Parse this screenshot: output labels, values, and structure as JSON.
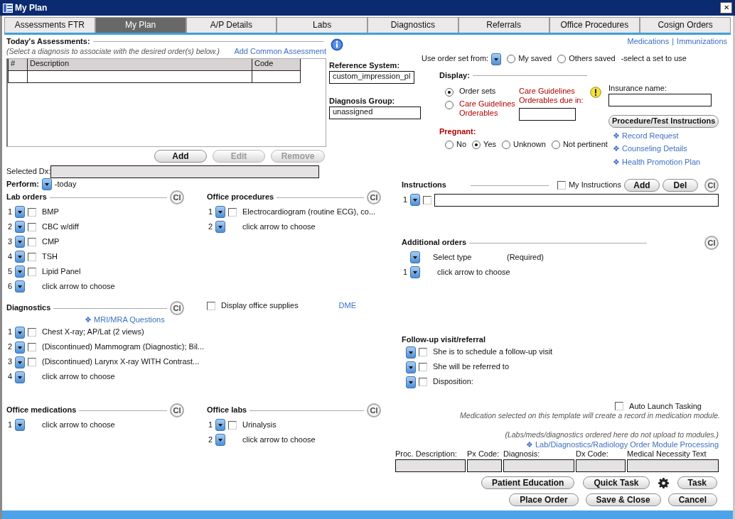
{
  "window": {
    "title": "My Plan",
    "close": "✕"
  },
  "tabs": [
    {
      "label": "Assessments FTR",
      "selected": false
    },
    {
      "label": "My Plan",
      "selected": true
    },
    {
      "label": "A/P Details",
      "selected": false
    },
    {
      "label": "Labs",
      "selected": false
    },
    {
      "label": "Diagnostics",
      "selected": false
    },
    {
      "label": "Referrals",
      "selected": false
    },
    {
      "label": "Office Procedures",
      "selected": false
    },
    {
      "label": "Cosign Orders",
      "selected": false
    }
  ],
  "assessments": {
    "title": "Today's Assessments:",
    "hint": "(Select a diagnosis to associate with the desired order(s) below.)",
    "add_common_link": "Add Common Assessment",
    "columns": [
      "#",
      "Description",
      "Code"
    ],
    "buttons": [
      {
        "label": "Add",
        "disabled": false
      },
      {
        "label": "Edit",
        "disabled": true
      },
      {
        "label": "Remove",
        "disabled": true
      }
    ],
    "selected_dx_label": "Selected Dx:"
  },
  "reference_system": {
    "label": "Reference System:",
    "value": "custom_impression_pl"
  },
  "diagnosis_group": {
    "label": "Diagnosis Group:",
    "value": "unassigned"
  },
  "top_links": {
    "items": [
      "Medications",
      "Immunizations"
    ],
    "separator": "|"
  },
  "order_set": {
    "label": "Use order set from:",
    "options": [
      {
        "label": "My saved",
        "selected": false
      },
      {
        "label": "Others saved",
        "selected": false
      }
    ],
    "hint": "-select a set to use"
  },
  "display": {
    "label": "Display:",
    "options": [
      {
        "label": "Order sets",
        "selected": true
      },
      {
        "label": "Care Guidelines Orderables",
        "selected": false
      }
    ],
    "due_label": "Care Guidelines Orderables due in:"
  },
  "insurance": {
    "label": "Insurance name:"
  },
  "procedure_button": "Procedure/Test Instructions",
  "side_links": [
    "❖ Record Request",
    "❖ Counseling Details",
    "❖ Health Promotion Plan"
  ],
  "pregnant": {
    "label": "Pregnant:",
    "options": [
      {
        "label": "No",
        "selected": false
      },
      {
        "label": "Yes",
        "selected": true
      },
      {
        "label": "Unknown",
        "selected": false
      },
      {
        "label": "Not pertinent",
        "selected": false
      }
    ]
  },
  "perform": {
    "label": "Perform:",
    "value": "-today"
  },
  "lab_orders": {
    "title": "Lab orders",
    "clear": "Cl",
    "rows": [
      {
        "number": "1",
        "kind": "item",
        "text": "BMP",
        "checked": false
      },
      {
        "number": "2",
        "kind": "item",
        "text": "CBC w/diff",
        "checked": false
      },
      {
        "number": "3",
        "kind": "item",
        "text": "CMP",
        "checked": false
      },
      {
        "number": "4",
        "kind": "item",
        "text": "TSH",
        "checked": false
      },
      {
        "number": "5",
        "kind": "item",
        "text": "Lipid Panel",
        "checked": false
      },
      {
        "number": "6",
        "kind": "choose",
        "text": "click arrow to choose"
      }
    ]
  },
  "office_procedures": {
    "title": "Office procedures",
    "clear": "Cl",
    "rows": [
      {
        "number": "1",
        "kind": "item",
        "text": "Electrocardiogram (routine ECG), co...",
        "checked": false
      },
      {
        "number": "2",
        "kind": "choose",
        "text": "click arrow to choose"
      }
    ]
  },
  "diagnostics": {
    "title": "Diagnostics",
    "clear": "Cl",
    "link": "❖ MRI/MRA Questions",
    "rows": [
      {
        "number": "1",
        "kind": "item",
        "text": "Chest X-ray; AP/Lat (2 views)",
        "checked": false
      },
      {
        "number": "2",
        "kind": "item",
        "text": "(Discontinued) Mammogram (Diagnostic); Bil...",
        "checked": false
      },
      {
        "number": "3",
        "kind": "item",
        "text": "(Discontinued) Larynx X-ray WITH Contrast...",
        "checked": false
      },
      {
        "number": "4",
        "kind": "choose",
        "text": "click arrow to choose"
      }
    ]
  },
  "office_supplies": {
    "label": "Display office supplies",
    "checked": false,
    "link": "DME"
  },
  "office_medications": {
    "title": "Office medications",
    "clear": "Cl",
    "rows": [
      {
        "number": "1",
        "kind": "choose",
        "text": "click arrow to choose"
      }
    ]
  },
  "office_labs": {
    "title": "Office labs",
    "clear": "Cl",
    "rows": [
      {
        "number": "1",
        "kind": "item",
        "text": "Urinalysis",
        "checked": false
      },
      {
        "number": "2",
        "kind": "choose",
        "text": "click arrow to choose"
      }
    ]
  },
  "instructions": {
    "title": "Instructions",
    "my_instructions": {
      "label": "My Instructions",
      "checked": false
    },
    "buttons": [
      "Add",
      "Del"
    ],
    "clear": "Cl",
    "rows": [
      {
        "number": "1",
        "checked": false
      }
    ]
  },
  "additional_orders": {
    "title": "Additional orders",
    "clear": "Cl",
    "type_label": "Select type",
    "required": "(Required)",
    "rows": [
      {
        "number": "1",
        "kind": "choose",
        "text": "click arrow to choose"
      }
    ]
  },
  "follow_up": {
    "title": "Follow-up visit/referral",
    "rows": [
      {
        "kind": "item",
        "text": "She is to schedule a follow-up visit",
        "checked": false
      },
      {
        "kind": "item",
        "text": "She will be referred to",
        "checked": false
      },
      {
        "kind": "item",
        "text": "Disposition:",
        "checked": false
      }
    ]
  },
  "tasking": {
    "auto_launch": {
      "label": "Auto Launch Tasking",
      "checked": false
    },
    "medication_note": "Medication selected on this template will create a record in medication module.",
    "upload_note": "(Labs/meds/diagnostics ordered here do not upload to modules.)",
    "processing_link": "❖ Lab/Diagnostics/Radiology Order Module Processing"
  },
  "proc_fields": [
    "Proc. Description:",
    "Px Code:",
    "Diagnosis:",
    "Dx Code:",
    "Medical Necessity Text"
  ],
  "action_rows": [
    [
      {
        "kind": "button",
        "label": "Patient Education"
      },
      {
        "kind": "button",
        "label": "Quick Task"
      },
      {
        "kind": "gear"
      },
      {
        "kind": "button",
        "label": "Task"
      }
    ],
    [
      {
        "kind": "button",
        "label": "Place Order"
      },
      {
        "kind": "button",
        "label": "Save & Close"
      },
      {
        "kind": "button",
        "label": "Cancel"
      }
    ]
  ]
}
